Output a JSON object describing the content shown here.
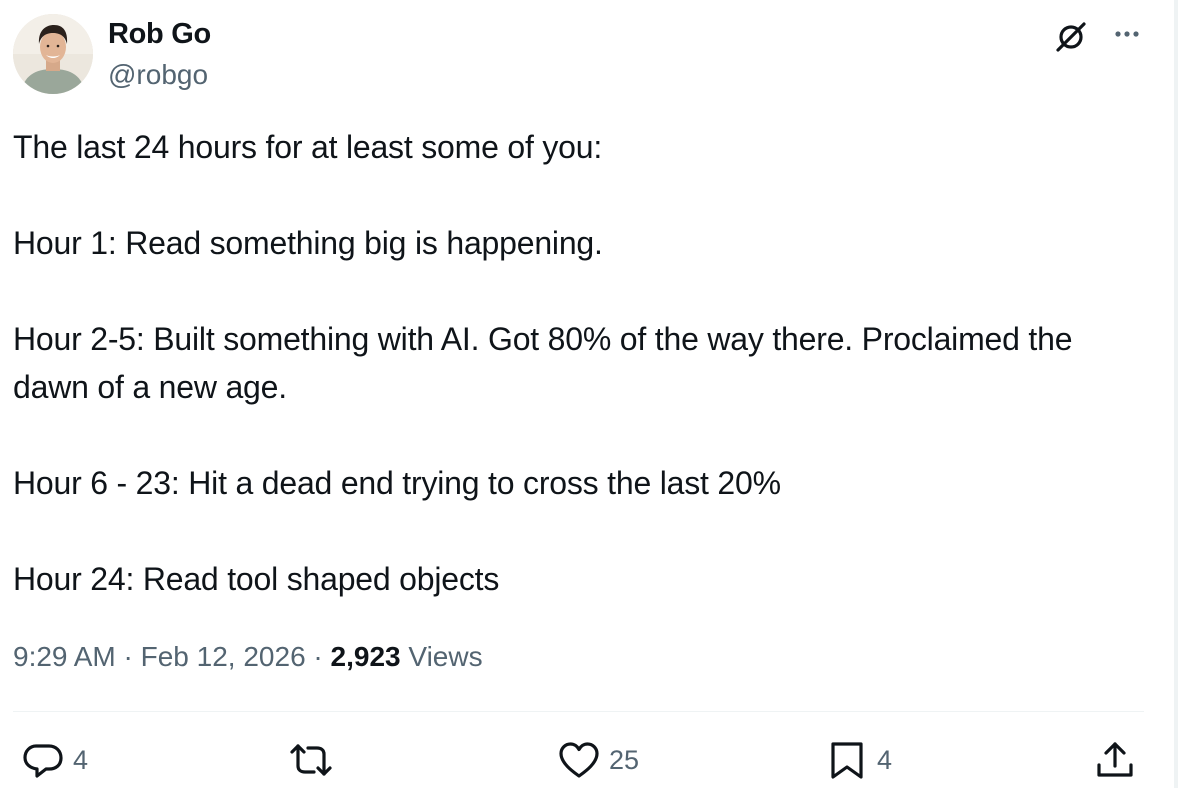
{
  "author": {
    "name": "Rob Go",
    "handle": "@robgo",
    "avatar_icon": "profile-photo"
  },
  "header_actions": {
    "grok_icon": "grok-icon",
    "more_icon": "more-icon"
  },
  "tweet": {
    "paragraphs": [
      "The last 24 hours for at least some of you:",
      "Hour 1: Read something big is happening.",
      "Hour 2-5: Built something with AI. Got 80% of the way there. Proclaimed the dawn of a new age.",
      "Hour 6 - 23: Hit a dead end trying to cross the last 20%",
      "Hour 24: Read tool shaped objects"
    ]
  },
  "meta": {
    "time": "9:29 AM",
    "separator": " · ",
    "date": "Feb 12, 2026",
    "views_count": "2,923",
    "views_label": "Views"
  },
  "actions": {
    "reply": {
      "icon": "reply-icon",
      "count": "4"
    },
    "repost": {
      "icon": "repost-icon",
      "count": ""
    },
    "like": {
      "icon": "heart-icon",
      "count": "25"
    },
    "bookmark": {
      "icon": "bookmark-icon",
      "count": "4"
    },
    "share": {
      "icon": "share-icon",
      "count": ""
    }
  },
  "colors": {
    "text_primary": "#0f1419",
    "text_secondary": "#536471",
    "divider": "#eff3f4",
    "background": "#ffffff"
  }
}
